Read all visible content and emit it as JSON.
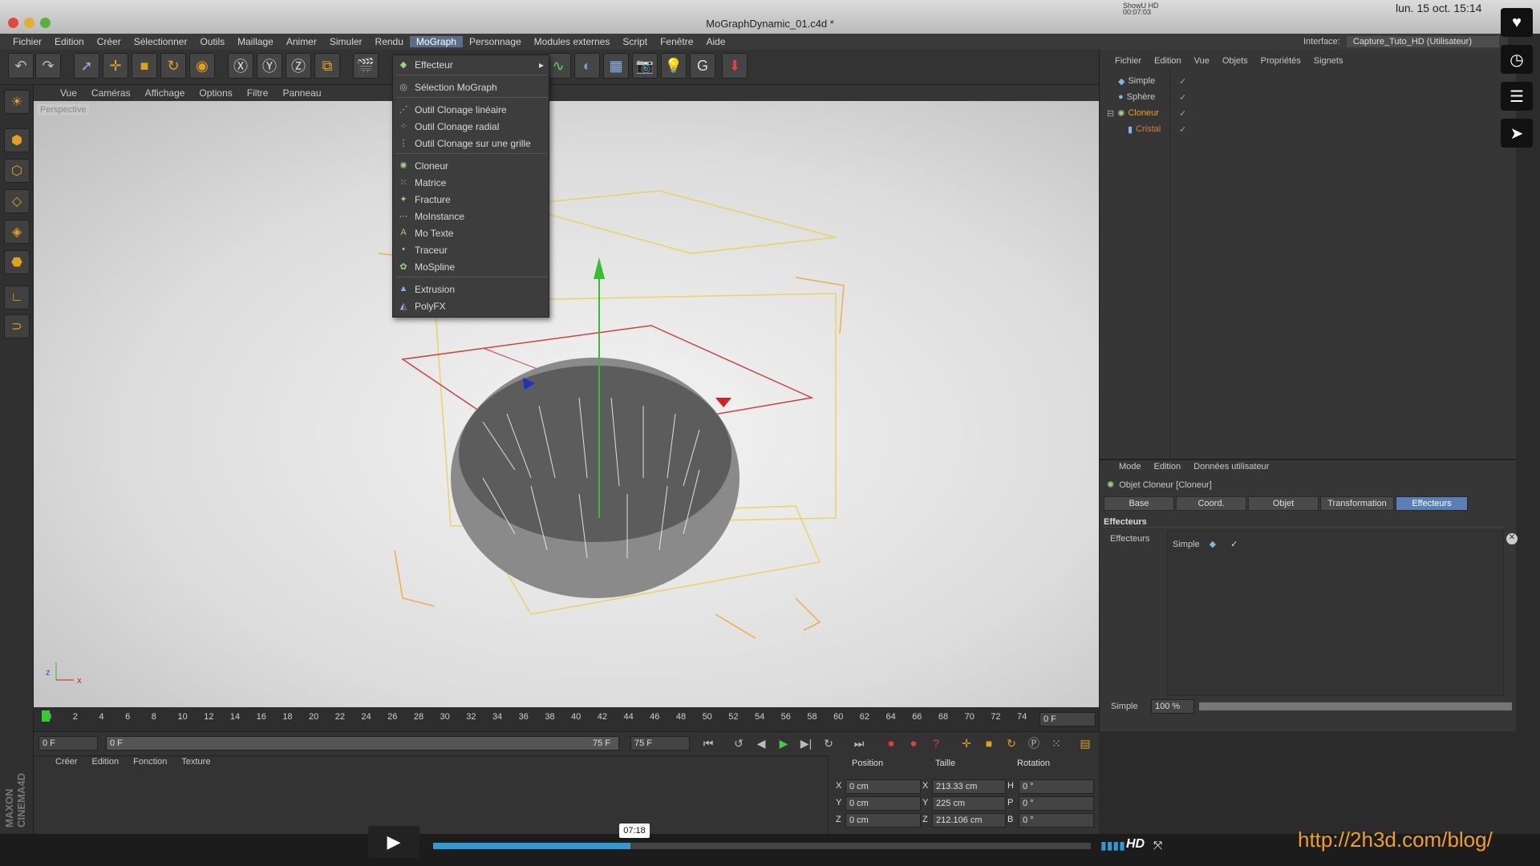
{
  "window": {
    "title": "MoGraphDynamic_01.c4d *"
  },
  "system_bar": {
    "datetime": "lun. 15 oct.  15:14",
    "showhd": "ShowU HD",
    "showhd_time": "00:07:03"
  },
  "menubar": {
    "items": [
      "Fichier",
      "Edition",
      "Créer",
      "Sélectionner",
      "Outils",
      "Maillage",
      "Animer",
      "Simuler",
      "Rendu",
      "MoGraph",
      "Personnage",
      "Modules externes",
      "Script",
      "Fenêtre",
      "Aide"
    ],
    "active": "MoGraph"
  },
  "interface": {
    "label": "Interface:",
    "value": "Capture_Tuto_HD (Utilisateur)"
  },
  "viewport": {
    "menu": [
      "Vue",
      "Caméras",
      "Affichage",
      "Options",
      "Filtre",
      "Panneau"
    ],
    "label": "Perspective"
  },
  "mograph_menu": {
    "items": [
      {
        "label": "Effecteur",
        "icon": "effector-icon",
        "submenu": true
      },
      {
        "label": "Sélection MoGraph",
        "icon": "selection-icon"
      },
      {
        "label": "Outil Clonage linéaire",
        "icon": "linear-clone-icon"
      },
      {
        "label": "Outil Clonage radial",
        "icon": "radial-clone-icon"
      },
      {
        "label": "Outil Clonage sur une grille",
        "icon": "grid-clone-icon"
      },
      {
        "label": "Cloneur",
        "icon": "cloner-icon"
      },
      {
        "label": "Matrice",
        "icon": "matrix-icon"
      },
      {
        "label": "Fracture",
        "icon": "fracture-icon"
      },
      {
        "label": "MoInstance",
        "icon": "moinstance-icon"
      },
      {
        "label": "Mo Texte",
        "icon": "motext-icon"
      },
      {
        "label": "Traceur",
        "icon": "tracer-icon"
      },
      {
        "label": "MoSpline",
        "icon": "mospline-icon"
      },
      {
        "label": "Extrusion",
        "icon": "extrude-icon"
      },
      {
        "label": "PolyFX",
        "icon": "polyfx-icon"
      }
    ]
  },
  "object_manager": {
    "menu": [
      "Fichier",
      "Edition",
      "Vue",
      "Objets",
      "Propriétés",
      "Signets"
    ],
    "objects": [
      {
        "name": "Simple",
        "color": "#c8c8c8"
      },
      {
        "name": "Sphère",
        "color": "#c8c8c8"
      },
      {
        "name": "Cloneur",
        "color": "#f0a020"
      },
      {
        "name": "Cristal",
        "color": "#d08040"
      }
    ]
  },
  "attributes": {
    "menu": [
      "Mode",
      "Edition",
      "Données utilisateur"
    ],
    "title": "Objet Cloneur [Cloneur]",
    "tabs": [
      "Base",
      "Coord.",
      "Objet",
      "Transformation",
      "Effecteurs"
    ],
    "active_tab": "Effecteurs",
    "section": "Effecteurs",
    "field_label": "Effecteurs",
    "effector": "Simple",
    "slider_label": "Simple",
    "slider_value": "100 %"
  },
  "timeline": {
    "ticks": [
      "0",
      "2",
      "4",
      "6",
      "8",
      "10",
      "12",
      "14",
      "16",
      "18",
      "20",
      "22",
      "24",
      "26",
      "28",
      "30",
      "32",
      "34",
      "36",
      "38",
      "40",
      "42",
      "44",
      "46",
      "48",
      "50",
      "52",
      "54",
      "56",
      "58",
      "60",
      "62",
      "64",
      "66",
      "68",
      "70",
      "72",
      "74"
    ],
    "current": "0 F"
  },
  "transport": {
    "start": "0 F",
    "range_start": "0 F",
    "range_end": "75 F",
    "end": "75 F"
  },
  "material_manager": {
    "menu": [
      "Créer",
      "Edition",
      "Fonction",
      "Texture"
    ]
  },
  "coordinates": {
    "headers": [
      "Position",
      "Taille",
      "Rotation"
    ],
    "rows": [
      {
        "axis": "X",
        "pos": "0 cm",
        "size_axis": "X",
        "size": "213.33 cm",
        "rot_axis": "H",
        "rot": "0 °"
      },
      {
        "axis": "Y",
        "pos": "0 cm",
        "size_axis": "Y",
        "size": "225 cm",
        "rot_axis": "P",
        "rot": "0 °"
      },
      {
        "axis": "Z",
        "pos": "0 cm",
        "size_axis": "Z",
        "size": "212.106 cm",
        "rot_axis": "B",
        "rot": "0 °"
      }
    ]
  },
  "branding": {
    "maxon": "MAXON CINEMA4D"
  },
  "video_player": {
    "time": "07:18",
    "progress": 0.3,
    "hd": "HD",
    "url": "http://2h3d.com/blog/"
  }
}
